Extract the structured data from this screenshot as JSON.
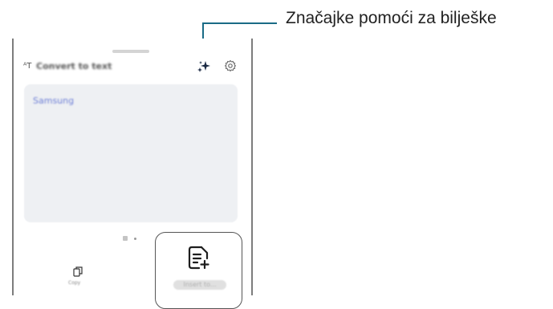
{
  "callout": {
    "text": "Značajke pomoći za bilješke"
  },
  "panel": {
    "title": "Convert to text",
    "title_icon": "handwriting-to-text-icon",
    "assist_icon": "sparkle-assist-icon",
    "settings_icon": "gear-icon",
    "card_text": "Samsung",
    "page_indicator": {
      "count": 2,
      "active": 0
    },
    "copy_button": {
      "label": "Copy",
      "icon": "copy-icon"
    },
    "insert_button": {
      "label": "Insert to...",
      "icon": "note-add-icon"
    }
  },
  "colors": {
    "callout_line": "#1a6b86",
    "card_bg": "#eef0f3",
    "card_text": "#6e7fd6"
  }
}
